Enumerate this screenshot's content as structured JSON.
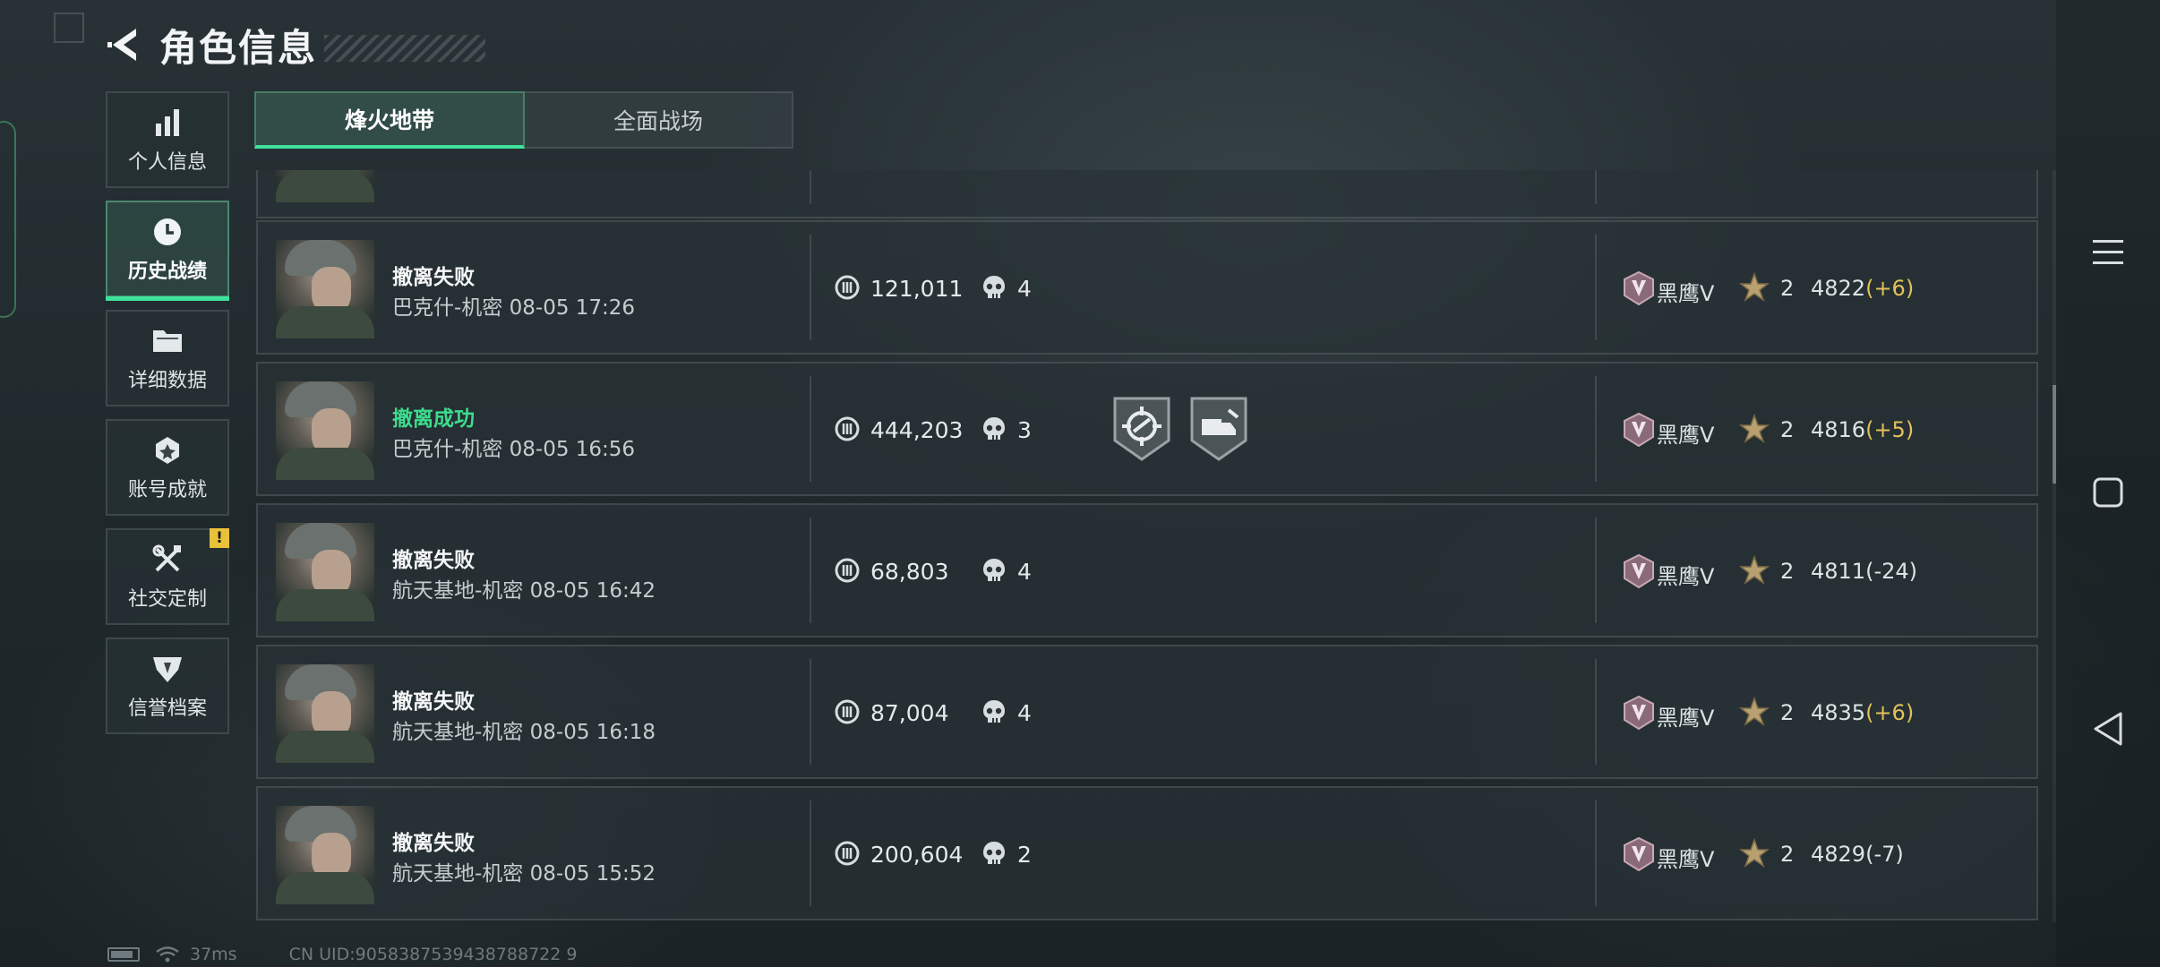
{
  "header": {
    "title": "角色信息",
    "back_icon": "back-arrow-icon"
  },
  "sidebar": {
    "items": [
      {
        "label": "个人信息",
        "icon": "bar-chart-icon",
        "active": false
      },
      {
        "label": "历史战绩",
        "icon": "clock-icon",
        "active": true
      },
      {
        "label": "详细数据",
        "icon": "folder-icon",
        "active": false
      },
      {
        "label": "账号成就",
        "icon": "achievement-icon",
        "active": false
      },
      {
        "label": "社交定制",
        "icon": "tools-icon",
        "active": false,
        "badge": "!"
      },
      {
        "label": "信誉档案",
        "icon": "credit-shield-icon",
        "active": false
      }
    ]
  },
  "tabs": [
    {
      "label": "烽火地带",
      "active": true
    },
    {
      "label": "全面战场",
      "active": false
    }
  ],
  "matches": [
    {
      "result": "撤离失败",
      "success": false,
      "map": "巴克什-机密",
      "time": "08-05 17:26",
      "value": "121,011",
      "kills": "4",
      "medals": [],
      "rank": "黑鹰V",
      "stars": "2",
      "score": "4822",
      "delta": "(+6)",
      "delta_up": true
    },
    {
      "result": "撤离成功",
      "success": true,
      "map": "巴克什-机密",
      "time": "08-05 16:56",
      "value": "444,203",
      "kills": "3",
      "medals": [
        "crosshair-medal-icon",
        "cargo-medal-icon"
      ],
      "rank": "黑鹰V",
      "stars": "2",
      "score": "4816",
      "delta": "(+5)",
      "delta_up": true
    },
    {
      "result": "撤离失败",
      "success": false,
      "map": "航天基地-机密",
      "time": "08-05 16:42",
      "value": "68,803",
      "kills": "4",
      "medals": [],
      "rank": "黑鹰V",
      "stars": "2",
      "score": "4811",
      "delta": "(-24)",
      "delta_up": false
    },
    {
      "result": "撤离失败",
      "success": false,
      "map": "航天基地-机密",
      "time": "08-05 16:18",
      "value": "87,004",
      "kills": "4",
      "medals": [],
      "rank": "黑鹰V",
      "stars": "2",
      "score": "4835",
      "delta": "(+6)",
      "delta_up": true
    },
    {
      "result": "撤离失败",
      "success": false,
      "map": "航天基地-机密",
      "time": "08-05 15:52",
      "value": "200,604",
      "kills": "2",
      "medals": [],
      "rank": "黑鹰V",
      "stars": "2",
      "score": "4829",
      "delta": "(-7)",
      "delta_up": false
    }
  ],
  "status": {
    "ping": "37ms",
    "uid": "CN UID:9058387539438788722 9"
  },
  "colors": {
    "accent": "#3de29a",
    "success": "#3ddc8e",
    "delta_up": "#e3c25a"
  },
  "nav_icons": [
    "menu-icon",
    "home-square-icon",
    "back-triangle-icon"
  ]
}
